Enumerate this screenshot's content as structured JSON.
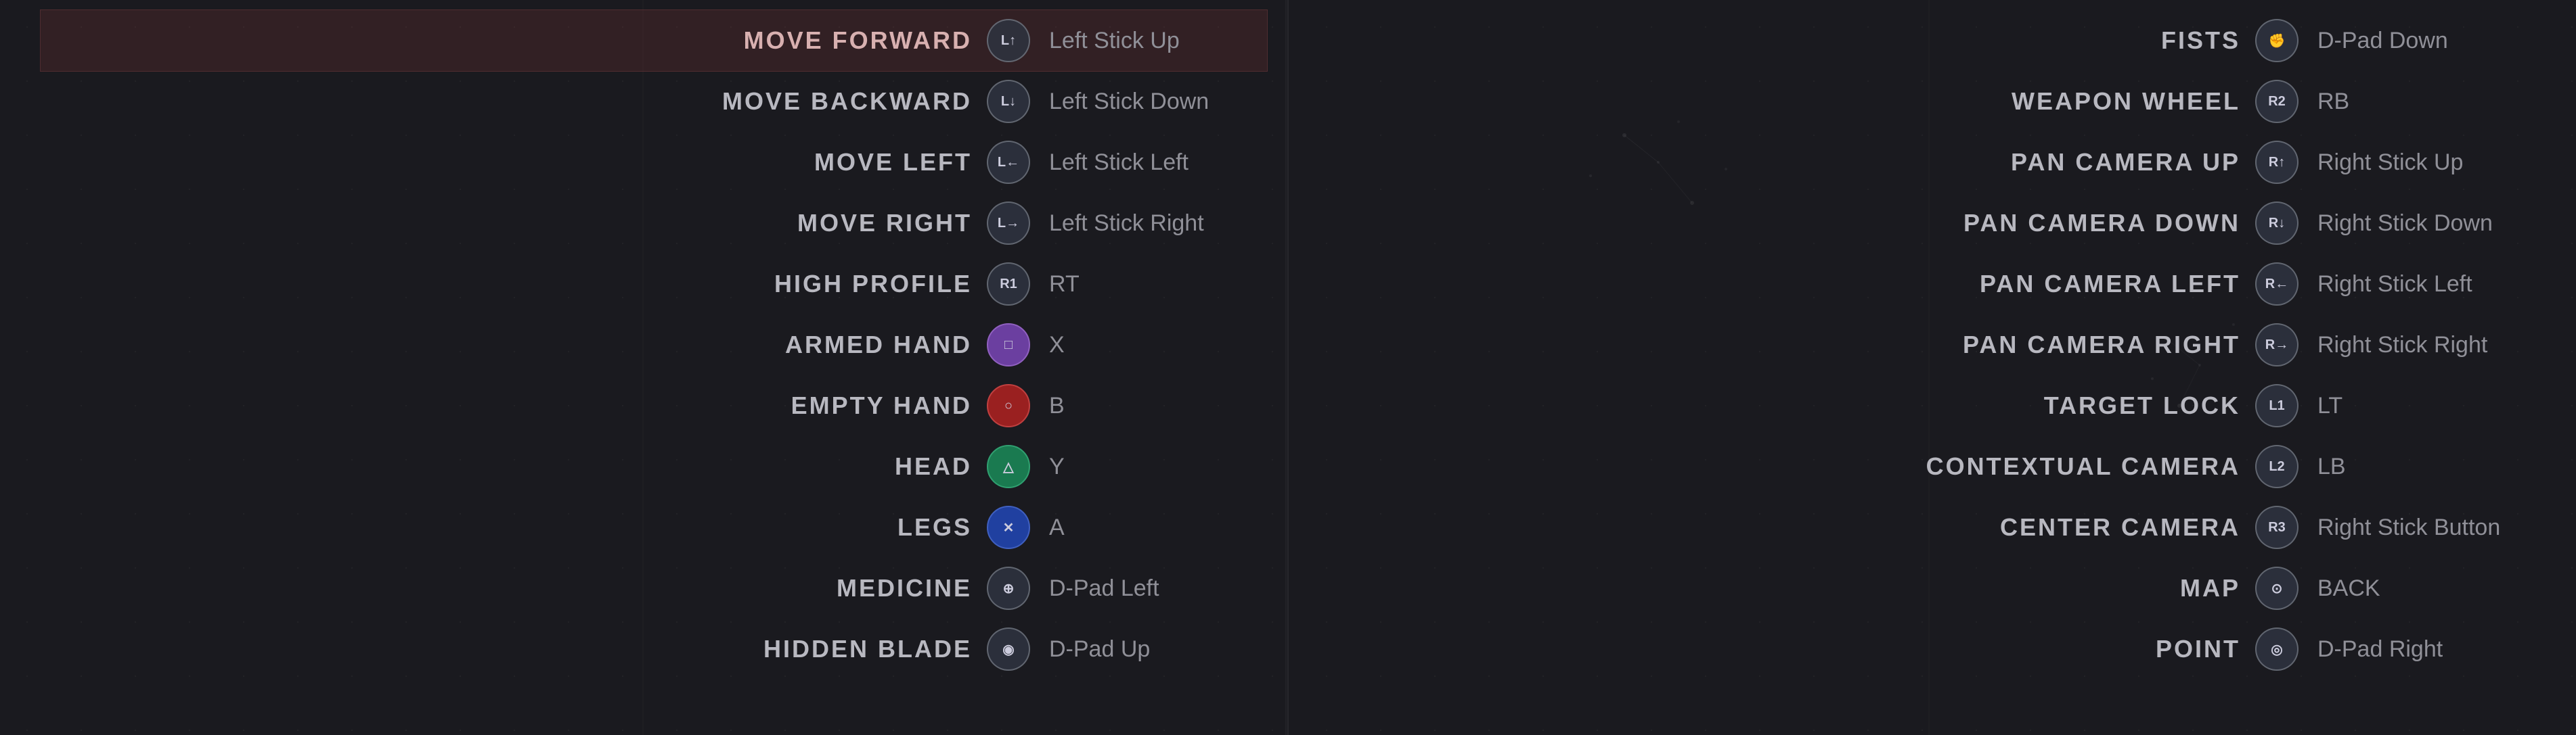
{
  "colors": {
    "highlight_bg": "rgba(150,60,60,0.2)",
    "text_normal": "#b8b8c0",
    "text_key": "#909098"
  },
  "left_panel": {
    "bindings": [
      {
        "action": "MOVE FORWARD",
        "icon_type": "dark",
        "icon_label": "L↑",
        "key": "Left Stick Up",
        "highlighted": true
      },
      {
        "action": "MOVE BACKWARD",
        "icon_type": "dark",
        "icon_label": "L↓",
        "key": "Left Stick Down",
        "highlighted": false
      },
      {
        "action": "MOVE LEFT",
        "icon_type": "dark",
        "icon_label": "L←",
        "key": "Left Stick Left",
        "highlighted": false
      },
      {
        "action": "MOVE RIGHT",
        "icon_type": "dark",
        "icon_label": "L→",
        "key": "Left Stick Right",
        "highlighted": false
      },
      {
        "action": "HIGH PROFILE",
        "icon_type": "dark",
        "icon_label": "R1",
        "key": "RT",
        "highlighted": false
      },
      {
        "action": "ARMED HAND",
        "icon_type": "purple",
        "icon_label": "□",
        "key": "X",
        "highlighted": false
      },
      {
        "action": "EMPTY HAND",
        "icon_type": "red",
        "icon_label": "○",
        "key": "B",
        "highlighted": false
      },
      {
        "action": "HEAD",
        "icon_type": "green",
        "icon_label": "△",
        "key": "Y",
        "highlighted": false
      },
      {
        "action": "LEGS",
        "icon_type": "blue",
        "icon_label": "✕",
        "key": "A",
        "highlighted": false
      },
      {
        "action": "MEDICINE",
        "icon_type": "dark",
        "icon_label": "⊕",
        "key": "D-Pad Left",
        "highlighted": false
      },
      {
        "action": "HIDDEN BLADE",
        "icon_type": "dark",
        "icon_label": "◉",
        "key": "D-Pad Up",
        "highlighted": false
      }
    ]
  },
  "right_panel": {
    "bindings": [
      {
        "action": "FISTS",
        "icon_type": "dark",
        "icon_label": "✊",
        "key": "D-Pad Down",
        "highlighted": false
      },
      {
        "action": "WEAPON WHEEL",
        "icon_type": "dark",
        "icon_label": "R2",
        "key": "RB",
        "highlighted": false
      },
      {
        "action": "PAN CAMERA UP",
        "icon_type": "dark",
        "icon_label": "R↑",
        "key": "Right Stick Up",
        "highlighted": false
      },
      {
        "action": "PAN CAMERA DOWN",
        "icon_type": "dark",
        "icon_label": "R↓",
        "key": "Right Stick Down",
        "highlighted": false
      },
      {
        "action": "PAN CAMERA LEFT",
        "icon_type": "dark",
        "icon_label": "R←",
        "key": "Right Stick Left",
        "highlighted": false
      },
      {
        "action": "PAN CAMERA RIGHT",
        "icon_type": "dark",
        "icon_label": "R→",
        "key": "Right Stick Right",
        "highlighted": false
      },
      {
        "action": "TARGET LOCK",
        "icon_type": "dark",
        "icon_label": "L1",
        "key": "LT",
        "highlighted": false
      },
      {
        "action": "CONTEXTUAL CAMERA",
        "icon_type": "dark",
        "icon_label": "L2",
        "key": "LB",
        "highlighted": false
      },
      {
        "action": "CENTER CAMERA",
        "icon_type": "dark",
        "icon_label": "R3",
        "key": "Right Stick Button",
        "highlighted": false
      },
      {
        "action": "MAP",
        "icon_type": "dark",
        "icon_label": "⊙",
        "key": "BACK",
        "highlighted": false
      },
      {
        "action": "POINT",
        "icon_type": "dark",
        "icon_label": "◎",
        "key": "D-Pad Right",
        "highlighted": false
      }
    ]
  }
}
